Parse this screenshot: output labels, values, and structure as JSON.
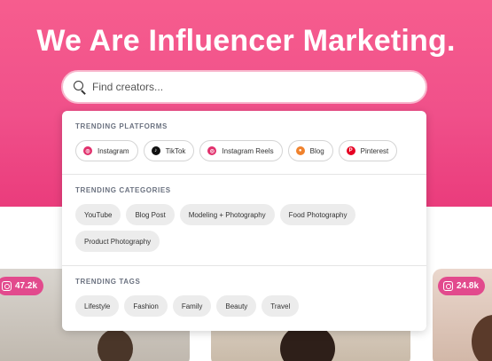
{
  "hero": {
    "headline": "We Are Influencer Marketing."
  },
  "search": {
    "placeholder": "Find creators..."
  },
  "dropdown": {
    "platforms": {
      "title": "TRENDING PLATFORMS",
      "items": [
        {
          "label": "Instagram",
          "icon": "instagram-icon",
          "color": "#e1306c"
        },
        {
          "label": "TikTok",
          "icon": "tiktok-icon",
          "color": "#111111"
        },
        {
          "label": "Instagram Reels",
          "icon": "instagram-reels-icon",
          "color": "#e1306c"
        },
        {
          "label": "Blog",
          "icon": "blog-icon",
          "color": "#f0822d"
        },
        {
          "label": "Pinterest",
          "icon": "pinterest-icon",
          "color": "#e60023"
        }
      ]
    },
    "categories": {
      "title": "TRENDING CATEGORIES",
      "items": [
        "YouTube",
        "Blog Post",
        "Modeling + Photography",
        "Food Photography",
        "Product Photography"
      ]
    },
    "tags": {
      "title": "TRENDING TAGS",
      "items": [
        "Lifestyle",
        "Fashion",
        "Family",
        "Beauty",
        "Travel"
      ]
    }
  },
  "cards": [
    {
      "followers": "47.2k",
      "platform_icon": "instagram-icon"
    },
    {
      "followers": "24.8k",
      "platform_icon": "instagram-icon"
    }
  ],
  "colors": {
    "hero_top": "#f65d8e",
    "hero_bottom": "#ea3c7c",
    "badge": "#e24a8d"
  }
}
